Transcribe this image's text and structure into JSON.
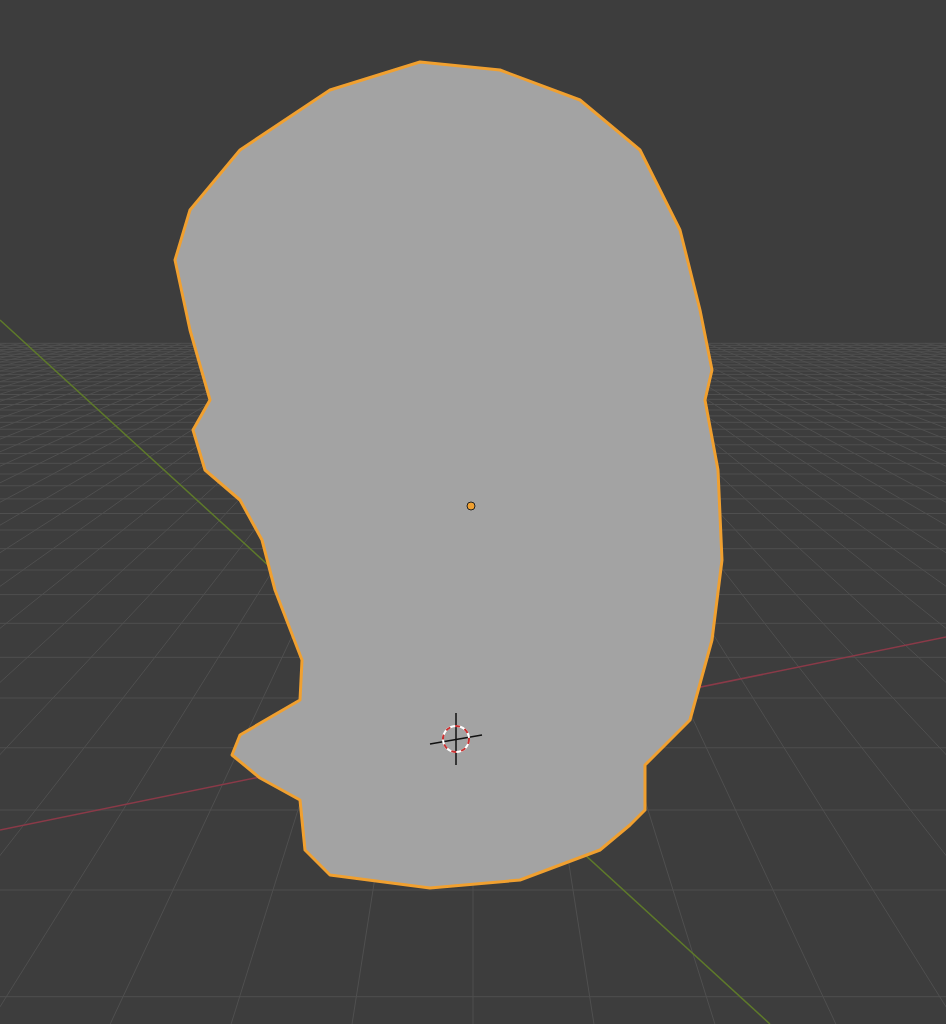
{
  "viewport": {
    "object_selected": true
  }
}
